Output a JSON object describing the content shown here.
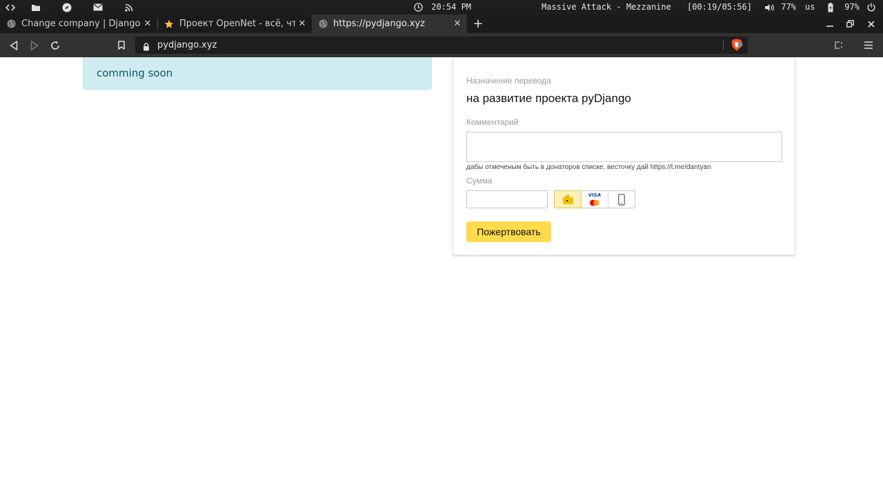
{
  "sysbar": {
    "clock": "20:54 PM",
    "now_playing": "Massive Attack - Mezzanine",
    "track_time": "[00:19/05:56]",
    "volume": "77%",
    "keyboard_layout": "us",
    "battery": "97%"
  },
  "tabs": [
    {
      "title": "Change company | Django",
      "active": false
    },
    {
      "title": "Проект OpenNet - всё, что",
      "active": false
    },
    {
      "title": "https://pydjango.xyz",
      "active": true
    }
  ],
  "toolbar": {
    "url": "pydjango.xyz"
  },
  "page": {
    "alert_text": "comming soon",
    "form": {
      "purpose_label": "Назначение перевода",
      "purpose_value": "на развитие проекта pyDjango",
      "comment_label": "Комментарий",
      "comment_value": "",
      "hint": "дабы отмеченым быть в донаторов списке, весточку дай https://t.me/dantyan",
      "amount_label": "Сумма",
      "amount_value": "",
      "payment_methods": [
        "yoomoney-wallet",
        "bank-card",
        "mobile-phone"
      ],
      "selected_method": "yoomoney-wallet",
      "card_brand": "VISA",
      "submit_label": "Пожертвовать"
    }
  },
  "colors": {
    "alert_bg": "#d1ecf1",
    "alert_text": "#0c5460",
    "donate_button": "#ffdb4d",
    "brave_shield": "#fb542b"
  }
}
